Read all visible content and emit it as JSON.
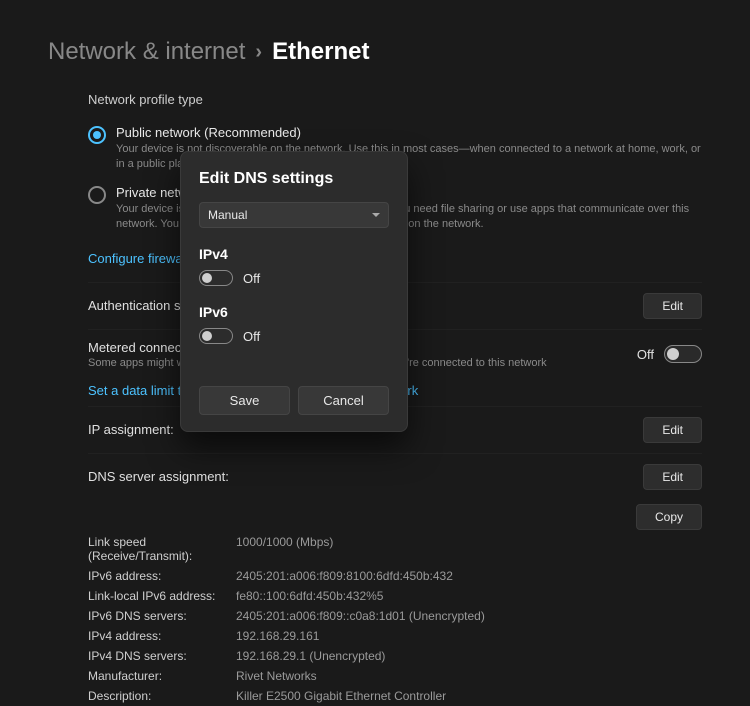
{
  "breadcrumb": {
    "parent": "Network & internet",
    "current": "Ethernet"
  },
  "profile": {
    "header": "Network profile type",
    "public_label": "Public network (Recommended)",
    "public_desc": "Your device is not discoverable on the network. Use this in most cases—when connected to a network at home, work, or in a public place.",
    "private_label": "Private network",
    "private_desc": "Your device is discoverable on the network. Select this if you need file sharing or use apps that communicate over this network. You should know and trust the people and devices on the network."
  },
  "links": {
    "firewall": "Configure firewall and security settings",
    "datalimit": "Set a data limit to help control data usage on this network"
  },
  "rows": {
    "auth_label": "Authentication settings",
    "metered_label": "Metered connection",
    "metered_desc": "Some apps might work differently to reduce data usage when you're connected to this network",
    "metered_toggle": "Off",
    "ip_label": "IP assignment:",
    "dns_label": "DNS server assignment:",
    "edit": "Edit",
    "copy": "Copy"
  },
  "info": {
    "speed_label": "Link speed (Receive/Transmit):",
    "speed_value": "1000/1000 (Mbps)",
    "ipv6addr_label": "IPv6 address:",
    "ipv6addr_value": "2405:201:a006:f809:8100:6dfd:450b:432",
    "linklocal_label": "Link-local IPv6 address:",
    "linklocal_value": "fe80::100:6dfd:450b:432%5",
    "ipv6dns_label": "IPv6 DNS servers:",
    "ipv6dns_value": "2405:201:a006:f809::c0a8:1d01 (Unencrypted)",
    "ipv4addr_label": "IPv4 address:",
    "ipv4addr_value": "192.168.29.161",
    "ipv4dns_label": "IPv4 DNS servers:",
    "ipv4dns_value": "192.168.29.1 (Unencrypted)",
    "manuf_label": "Manufacturer:",
    "manuf_value": "Rivet Networks",
    "desc_label": "Description:",
    "desc_value": "Killer E2500 Gigabit Ethernet Controller"
  },
  "modal": {
    "title": "Edit DNS settings",
    "select_value": "Manual",
    "ipv4_header": "IPv4",
    "ipv4_state": "Off",
    "ipv6_header": "IPv6",
    "ipv6_state": "Off",
    "save": "Save",
    "cancel": "Cancel"
  }
}
